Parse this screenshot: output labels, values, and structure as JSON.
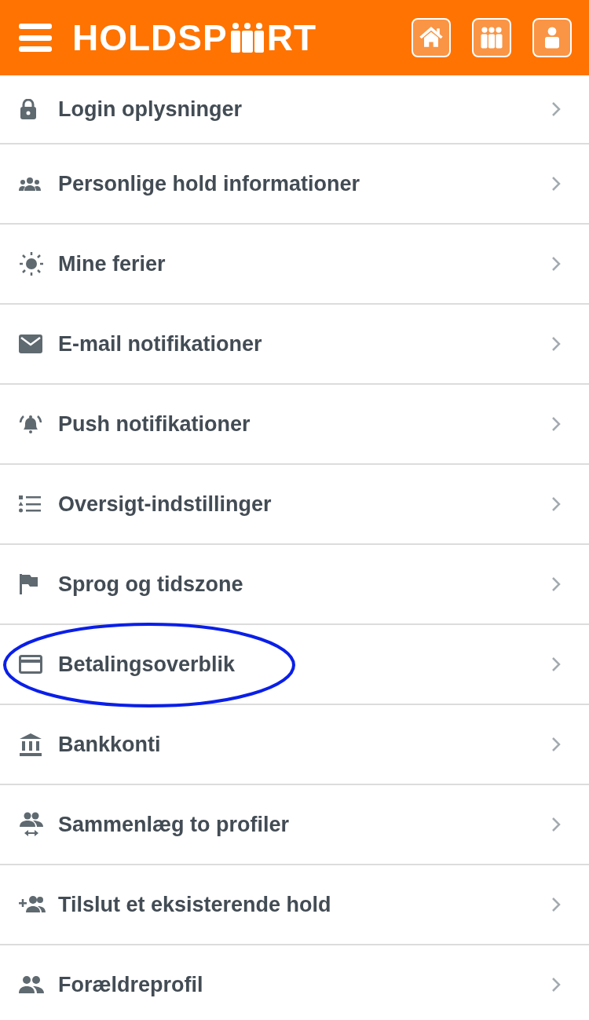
{
  "header": {
    "logo": {
      "before": "HOLDSP",
      "after": "RT"
    }
  },
  "items": [
    {
      "kind": "lock",
      "label": "Login oplysninger",
      "highlighted": false
    },
    {
      "kind": "group",
      "label": "Personlige hold informationer",
      "highlighted": false
    },
    {
      "kind": "sun",
      "label": "Mine ferier",
      "highlighted": false
    },
    {
      "kind": "mail",
      "label": "E-mail notifikationer",
      "highlighted": false
    },
    {
      "kind": "bell",
      "label": "Push notifikationer",
      "highlighted": false
    },
    {
      "kind": "list",
      "label": "Oversigt-indstillinger",
      "highlighted": false
    },
    {
      "kind": "flag",
      "label": "Sprog og tidszone",
      "highlighted": false
    },
    {
      "kind": "card",
      "label": "Betalingsoverblik",
      "highlighted": true
    },
    {
      "kind": "bank",
      "label": "Bankkonti",
      "highlighted": false
    },
    {
      "kind": "merge",
      "label": "Sammenlæg to profiler",
      "highlighted": false
    },
    {
      "kind": "addgroup",
      "label": "Tilslut et eksisterende hold",
      "highlighted": false
    },
    {
      "kind": "people",
      "label": "Forældreprofil",
      "highlighted": false
    }
  ]
}
